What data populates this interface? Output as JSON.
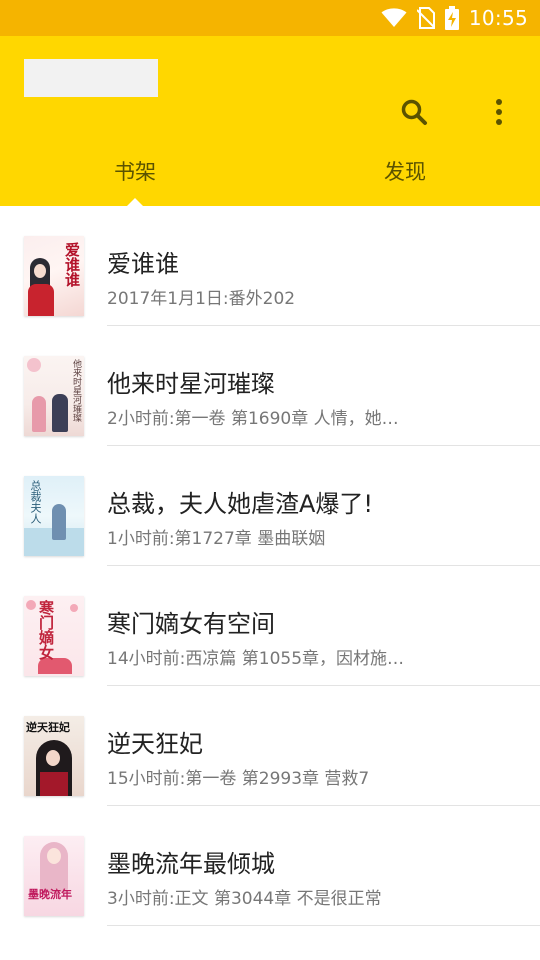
{
  "status_bar": {
    "time": "10:55",
    "icons": [
      "wifi-icon",
      "no-sim-icon",
      "battery-charging-icon"
    ]
  },
  "app_bar": {
    "actions": [
      "search-icon",
      "more-vert-icon"
    ]
  },
  "tabs": [
    {
      "label": "书架",
      "selected": true
    },
    {
      "label": "发现",
      "selected": false
    }
  ],
  "books": [
    {
      "title": "爱谁谁",
      "subtitle": "2017年1月1日:番外202",
      "cover_text": "爱谁谁"
    },
    {
      "title": "他来时星河璀璨",
      "subtitle": "2小时前:第一卷 第1690章 人情，她…",
      "cover_text": "他来时星河璀璨"
    },
    {
      "title": "总裁，夫人她虐渣A爆了!",
      "subtitle": "1小时前:第1727章 墨曲联姻",
      "cover_text": "总裁夫人"
    },
    {
      "title": "寒门嫡女有空间",
      "subtitle": "14小时前:西凉篇 第1055章，因材施…",
      "cover_text": "寒门嫡女"
    },
    {
      "title": "逆天狂妃",
      "subtitle": "15小时前:第一卷 第2993章 营救7",
      "cover_text": "逆天狂妃"
    },
    {
      "title": "墨晚流年最倾城",
      "subtitle": "3小时前:正文 第3044章 不是很正常",
      "cover_text": "墨晚流年"
    }
  ],
  "colors": {
    "status_bar": "#F5B400",
    "app_bar": "#FFD700",
    "tab_text": "#5b5300"
  }
}
